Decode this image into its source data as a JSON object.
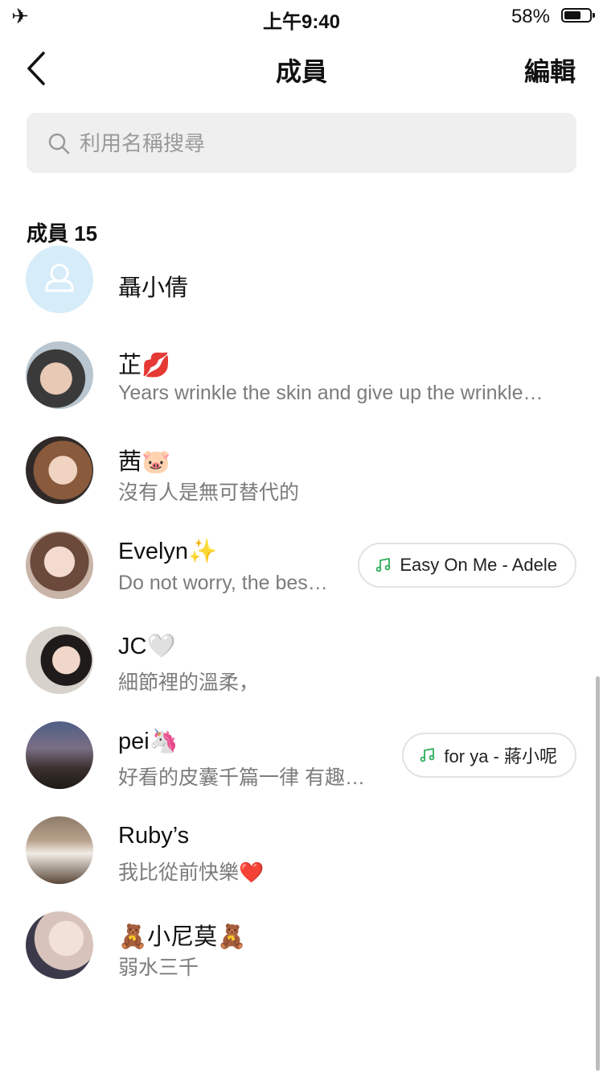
{
  "status": {
    "time": "上午9:40",
    "battery_pct": "58%",
    "battery_level": 0.58
  },
  "nav": {
    "title": "成員",
    "edit_label": "編輯"
  },
  "search": {
    "placeholder": "利用名稱搜尋"
  },
  "section": {
    "title": "成員 15"
  },
  "members": [
    {
      "name": "聶小倩",
      "bio": "",
      "music": ""
    },
    {
      "name": "芷💋",
      "bio": "Years wrinkle the skin and give up the wrinkle…",
      "music": ""
    },
    {
      "name": "茜🐷",
      "bio": "沒有人是無可替代的",
      "music": ""
    },
    {
      "name": "Evelyn✨",
      "bio": "Do not worry, the bes…",
      "music": "Easy On Me - Adele"
    },
    {
      "name": "JC🤍",
      "bio": "細節裡的溫柔，",
      "music": ""
    },
    {
      "name": "pei🦄",
      "bio": "好看的皮囊千篇一律 有趣…",
      "music": "for ya - 蔣小呢"
    },
    {
      "name": "Ruby’s",
      "bio": "我比從前快樂❤️",
      "music": ""
    },
    {
      "name": "🧸小尼莫🧸",
      "bio": "弱水三千",
      "music": ""
    }
  ],
  "colors": {
    "music_note": "#2fae5c",
    "placeholder_avatar_bg": "#d6ecf9"
  }
}
